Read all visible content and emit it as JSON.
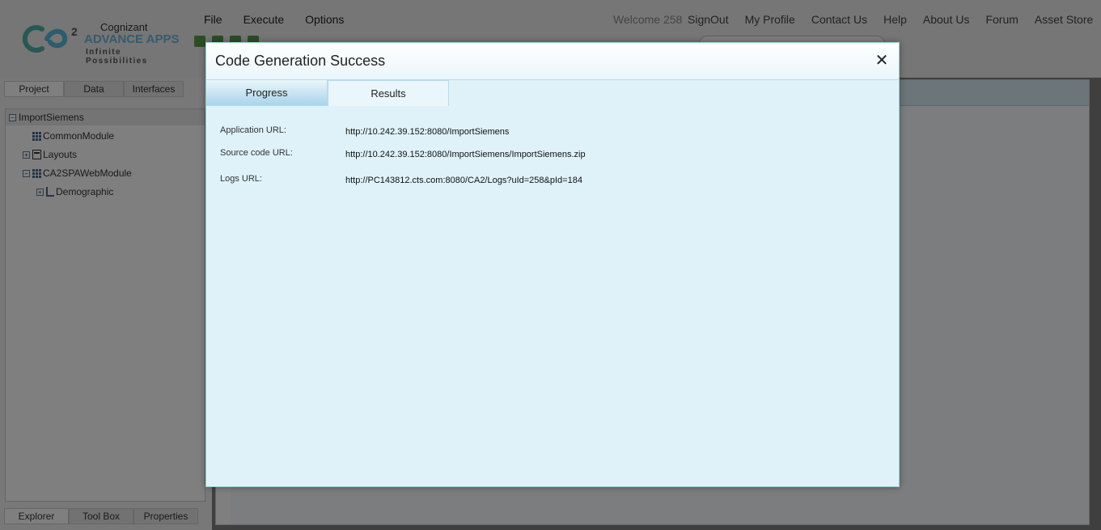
{
  "header": {
    "logo": {
      "brand": "Cognizant",
      "superscript": "2",
      "product": "ADVANCE APPS",
      "tagline": "Infinite Possibilities"
    },
    "menu": [
      "File",
      "Execute",
      "Options"
    ],
    "welcome": "Welcome  258",
    "links": [
      "SignOut",
      "My Profile",
      "Contact Us",
      "Help",
      "About Us",
      "Forum",
      "Asset Store"
    ]
  },
  "left_panel": {
    "tabs": [
      "Project",
      "Data",
      "Interfaces"
    ],
    "tree": {
      "root": "ImportSiemens",
      "items": [
        "CommonModule",
        "Layouts",
        "CA2SPAWebModule",
        "Demographic"
      ]
    },
    "bottom_tabs": [
      "Explorer",
      "Tool Box",
      "Properties"
    ]
  },
  "dialog": {
    "title": "Code Generation Success",
    "close_glyph": "✕",
    "tabs": [
      "Progress",
      "Results"
    ],
    "results": [
      {
        "label": "Application URL:",
        "value": "http://10.242.39.152:8080/ImportSiemens"
      },
      {
        "label": "Source code URL:",
        "value": "http://10.242.39.152:8080/ImportSiemens/ImportSiemens.zip"
      },
      {
        "label": "Logs URL:",
        "value": "http://PC143812.cts.com:8080/CA2/Logs?uId=258&pId=184"
      }
    ]
  },
  "colors": {
    "overlay": "#7f7f7f",
    "dialog_bg": "#dff2fa",
    "tab_inactive": "#a8d4ea",
    "logo_accent": "#6ab7d9"
  }
}
